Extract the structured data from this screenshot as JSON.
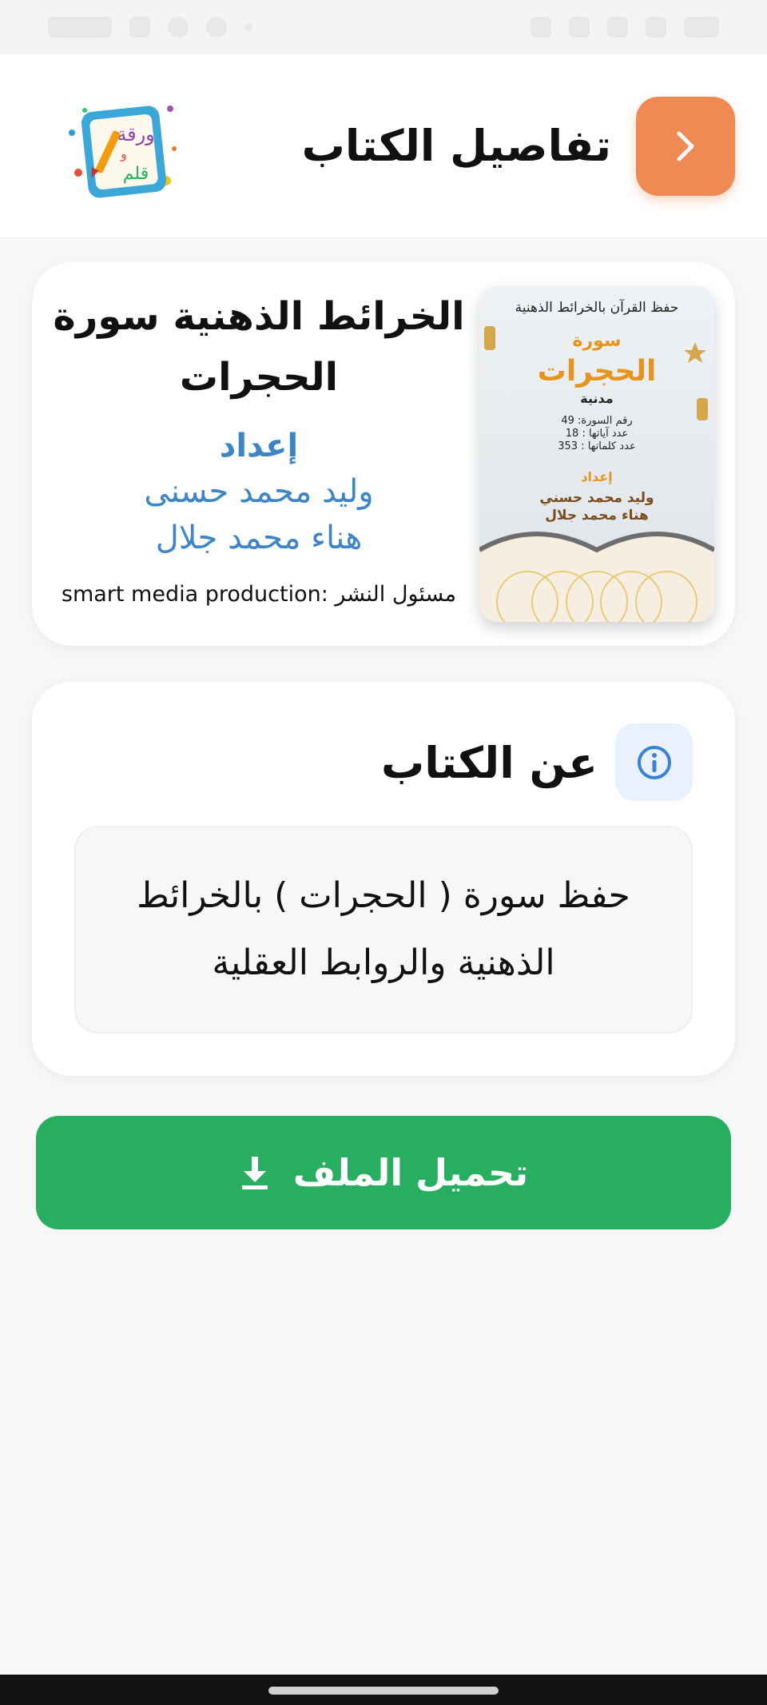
{
  "header": {
    "title": "تفاصيل الكتاب",
    "back_icon": "chevron-right-icon",
    "logo_text": "ورقة و قلم",
    "accent": "#ef8a55"
  },
  "book": {
    "title": "الخرائط الذهنية سورة الحجرات",
    "prep_label": "إعداد",
    "authors": [
      "وليد محمد حسنى",
      "هناء محمد جلال"
    ],
    "publisher": "مسئول النشر :smart media production",
    "cover": {
      "top_text": "حفظ القرآن بالخرائط الذهنية",
      "surah_label": "سورة",
      "surah_name": "الحجرات",
      "type": "مدنية",
      "info_lines": [
        "رقم السورة: 49",
        "عدد آياتها : 18",
        "عدد كلماتها : 353"
      ],
      "prep_label": "إعداد",
      "authors": [
        "وليد محمد حسني",
        "هناء محمد جلال"
      ]
    }
  },
  "about": {
    "title": "عن الكتاب",
    "icon": "info-icon",
    "description": "حفظ سورة ( الحجرات ) بالخرائط الذهنية والروابط العقلية"
  },
  "download": {
    "label": "تحميل الملف",
    "icon": "download-icon",
    "color": "#27ae60"
  }
}
